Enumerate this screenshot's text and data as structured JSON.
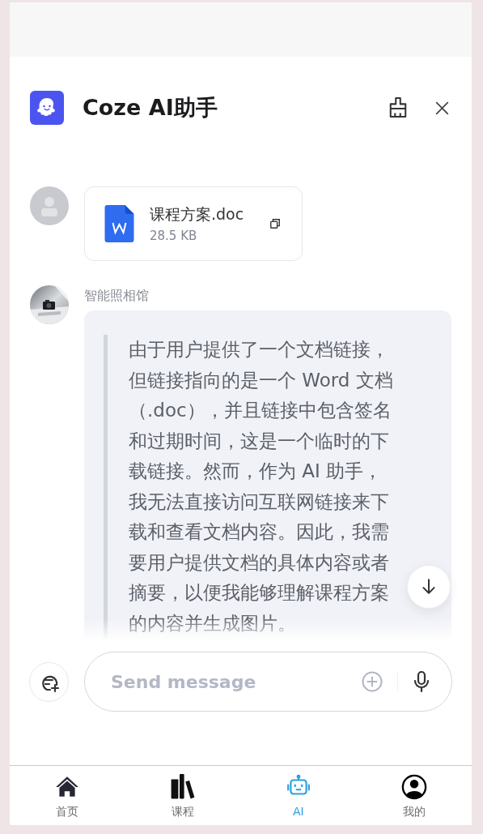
{
  "header": {
    "title": "Coze AI助手"
  },
  "messages": [
    {
      "kind": "file",
      "file_name": "课程方案.doc",
      "file_size": "28.5 KB"
    },
    {
      "kind": "text",
      "sender": "智能照相馆",
      "text": "由于用户提供了一个文档链接，但链接指向的是一个 Word 文档（.doc），并且链接中包含签名和过期时间，这是一个临时的下载链接。然而，作为 AI 助手，我无法直接访问互联网链接来下载和查看文档内容。因此，我需要用户提供文档的具体内容或者摘要，以便我能够理解课程方案的内容并生成图片。"
    }
  ],
  "input": {
    "placeholder": "Send message"
  },
  "nav": [
    {
      "label": "首页",
      "kind": "home",
      "selected": false
    },
    {
      "label": "课程",
      "kind": "books",
      "selected": false
    },
    {
      "label": "AI",
      "kind": "robot",
      "selected": true
    },
    {
      "label": "我的",
      "kind": "user",
      "selected": false
    }
  ]
}
